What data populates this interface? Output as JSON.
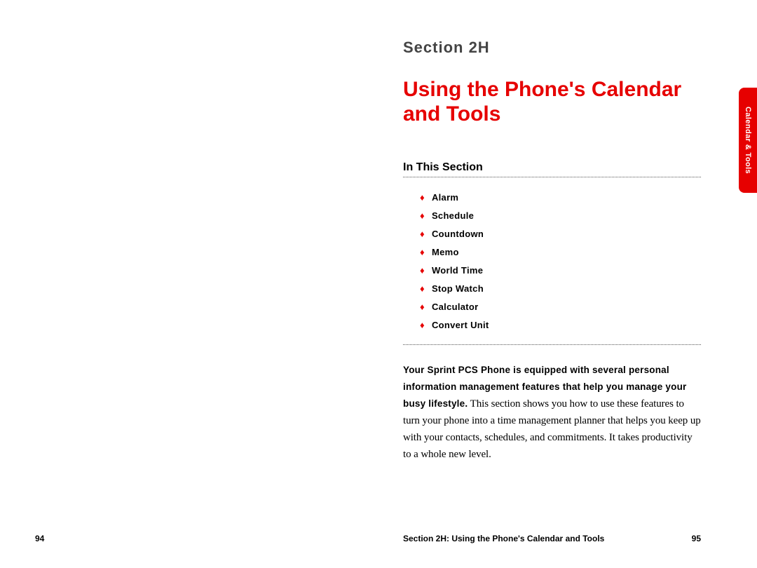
{
  "spread": {
    "left": {
      "page_number": "94"
    },
    "right": {
      "section_label": "Section 2H",
      "title_line1": "Using the Phone's Calendar",
      "title_line2": "and Tools",
      "in_this_section": "In This Section",
      "toc": [
        "Alarm",
        "Schedule",
        "Countdown",
        "Memo",
        "World Time",
        "Stop Watch",
        "Calculator",
        "Convert Unit"
      ],
      "body_bold": "Your Sprint PCS Phone is equipped with several personal information management features that help you manage your busy lifestyle.",
      "body_rest": " This section shows you how to use these features to turn your phone into a time management planner that helps you keep up with your contacts, schedules, and commitments. It takes productivity to a whole new level.",
      "footer_title": "Section 2H: Using the Phone's Calendar and Tools",
      "page_number": "95",
      "tab_label": "Calendar & Tools"
    }
  }
}
